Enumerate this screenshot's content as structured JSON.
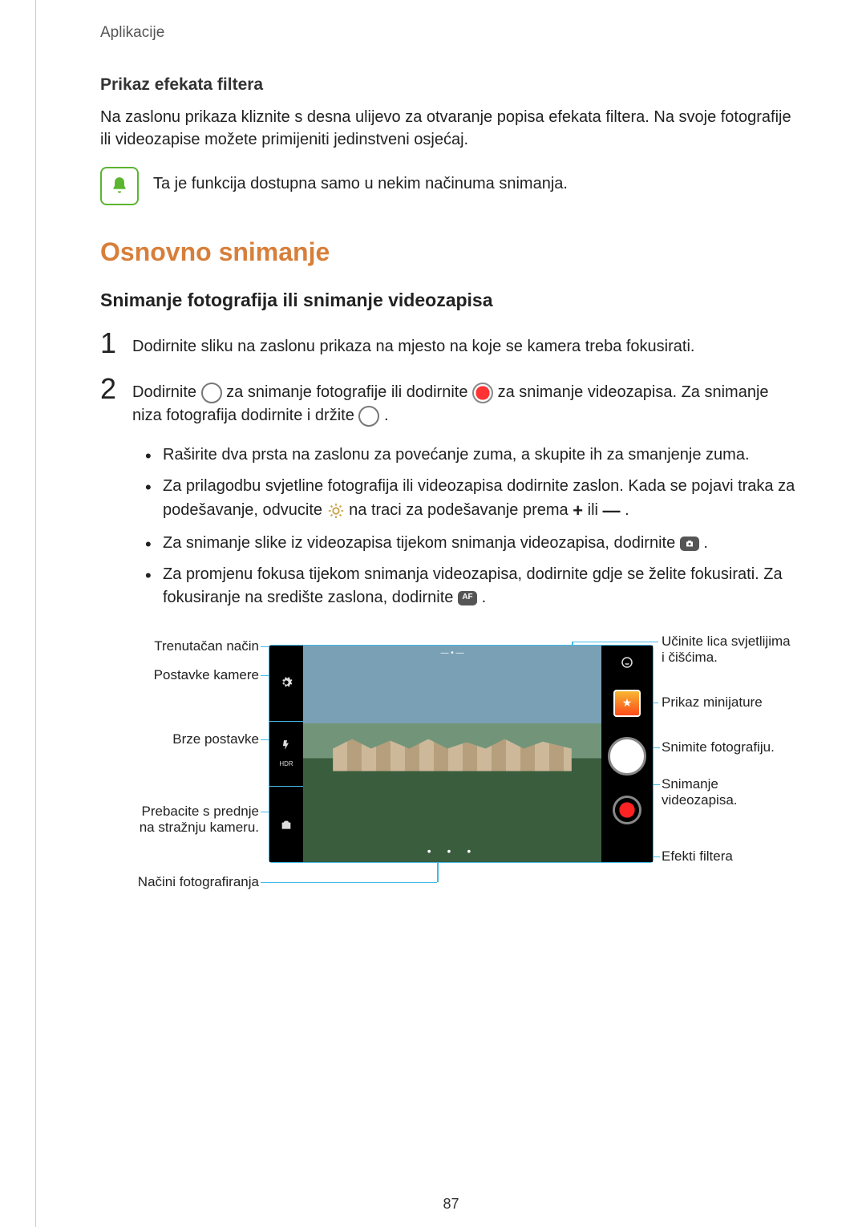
{
  "breadcrumb": "Aplikacije",
  "filter_heading": "Prikaz efekata filtera",
  "filter_body": "Na zaslonu prikaza kliznite s desna ulijevo za otvaranje popisa efekata filtera. Na svoje fotografije ili videozapise možete primijeniti jedinstveni osjećaj.",
  "note_text": "Ta je funkcija dostupna samo u nekim načinuma snimanja.",
  "h1": "Osnovno snimanje",
  "h2": "Snimanje fotografija ili snimanje videozapisa",
  "steps": {
    "n1": "1",
    "s1": "Dodirnite sliku na zaslonu prikaza na mjesto na koje se kamera treba fokusirati.",
    "n2": "2",
    "s2a": "Dodirnite ",
    "s2b": " za snimanje fotografije ili dodirnite ",
    "s2c": " za snimanje videozapisa. Za snimanje niza fotografija dodirnite i držite ",
    "s2d": "."
  },
  "bullets": {
    "b1": "Raširite dva prsta na zaslonu za povećanje zuma, a skupite ih za smanjenje zuma.",
    "b2a": "Za prilagodbu svjetline fotografija ili videozapisa dodirnite zaslon. Kada se pojavi traka za podešavanje, odvucite ",
    "b2b": " na traci za podešavanje prema ",
    "b2c": " ili ",
    "b2d": ".",
    "b3a": "Za snimanje slike iz videozapisa tijekom snimanja videozapisa, dodirnite ",
    "b3b": ".",
    "b4a": "Za promjenu fokusa tijekom snimanja videozapisa, dodirnite gdje se želite fokusirati. Za fokusiranje na središte zaslona, dodirnite ",
    "b4b": "."
  },
  "callouts": {
    "left": {
      "current_mode": "Trenutačan način",
      "camera_settings": "Postavke kamere",
      "quick_settings": "Brze postavke",
      "switch_camera_l1": "Prebacite s prednje",
      "switch_camera_l2": "na stražnju kameru.",
      "shooting_modes": "Načini fotografiranja"
    },
    "right": {
      "beauty_l1": "Učinite lica svjetlijima",
      "beauty_l2": "i čišćima.",
      "thumbnail": "Prikaz minijature",
      "take_photo": "Snimite fotografiju.",
      "record_l1": "Snimanje",
      "record_l2": "videozapisa.",
      "filter_effects": "Efekti filtera"
    }
  },
  "qs_labels": {
    "hdr": "HDR"
  },
  "page_number": "87"
}
